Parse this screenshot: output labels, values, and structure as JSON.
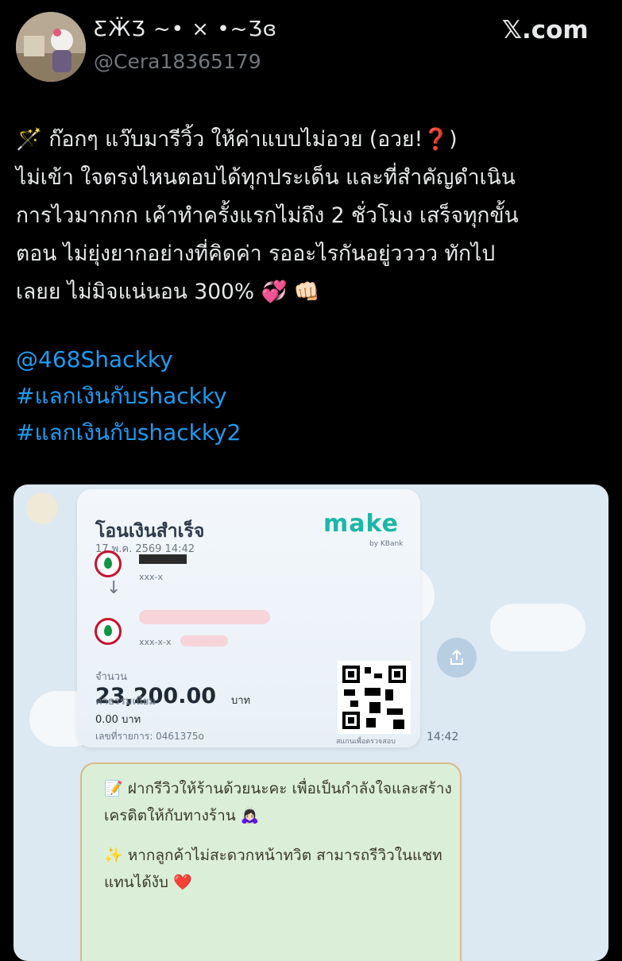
{
  "header": {
    "display_name": "ƸӜƷ ~• × •~Ʒɞ",
    "handle": "@Cera18365179",
    "brand": "𝕏.com"
  },
  "tweet": {
    "lines": [
      "🪄 ก๊อกๆ แว๊บมารีวิ้ว ให้ค่าแบบไม่อวย (อวย!❓)",
      "ไม่เข้า ใจตรงไหนตอบได้ทุกประเด็น และที่สำคัญดำเนิน",
      "การไวมากกก เค้าทำครั้งแรกไม่ถึง 2 ชั่วโมง เสร็จทุกขั้น",
      "ตอน ไม่ยุ่งยากอย่างที่คิดค่า รออะไรกันอยู่วววว ทักไป",
      "เลยย ไม่มิจแน่นอน 300% 💞 👊🏻"
    ],
    "mention": "@468Shackky",
    "hashtag1": "#แลกเงินกับshackky",
    "hashtag2": "#แลกเงินกับshackky2"
  },
  "media": {
    "slip": {
      "title": "โอนเงินสำเร็จ",
      "date": "17 พ.ค. 2569 14:42",
      "logo": "make",
      "logo_sub": "by KBank",
      "from_acct": "xxx-x",
      "to_acct": "xxx-x-x",
      "amount_label": "จำนวน",
      "amount": "23,200.00",
      "amount_unit": "บาท",
      "fee_label": "ค่าธรรมเนียม",
      "fee": "0.00 บาท",
      "ref_line": "เลขที่รายการ: 0461375o",
      "qr_caption": "สแกนเพื่อตรวจสอบ"
    },
    "time": "14:42",
    "review": {
      "line1": "📝 ฝากรีวิวให้ร้านด้วยนะคะ เพื่อเป็นกำลังใจและสร้างเครดิตให้กับทางร้าน 🙇🏻‍♀️",
      "line2": "✨ หากลูกค้าไม่สะดวกหน้าทวิต สามารถรีวิวในแชทแทนได้งับ ❤️"
    }
  }
}
